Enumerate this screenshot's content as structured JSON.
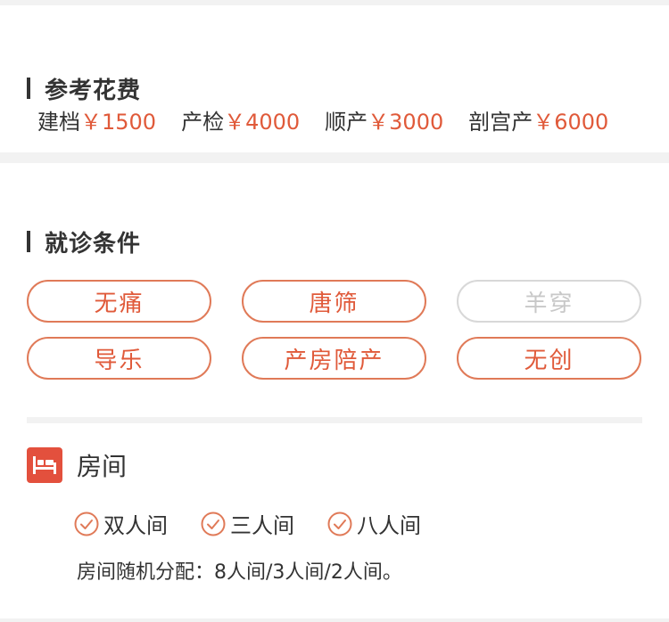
{
  "cost": {
    "title": "参考花费",
    "items": [
      {
        "label": "建档",
        "price": "￥1500"
      },
      {
        "label": "产检",
        "price": "￥4000"
      },
      {
        "label": "顺产",
        "price": "￥3000"
      },
      {
        "label": "剖宫产",
        "price": "￥6000"
      }
    ]
  },
  "conditions": {
    "title": "就诊条件",
    "tags": [
      {
        "label": "无痛",
        "enabled": true
      },
      {
        "label": "唐筛",
        "enabled": true
      },
      {
        "label": "羊穿",
        "enabled": false
      },
      {
        "label": "导乐",
        "enabled": true
      },
      {
        "label": "产房陪产",
        "enabled": true
      },
      {
        "label": "无创",
        "enabled": true
      }
    ]
  },
  "room": {
    "title": "房间",
    "icon": "bed-icon",
    "options": [
      "双人间",
      "三人间",
      "八人间"
    ],
    "note": "房间随机分配：8人间/3人间/2人间。"
  },
  "colors": {
    "accent": "#e05a3a",
    "tag_border": "#e07a58",
    "icon_bg": "#e3503d",
    "disabled": "#c8c8c8",
    "divider": "#f2f2f2"
  }
}
